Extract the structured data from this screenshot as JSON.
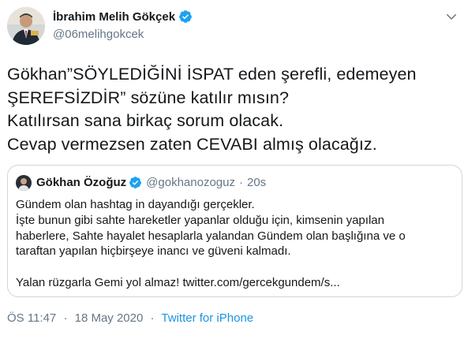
{
  "author": {
    "name": "İbrahim Melih Gökçek",
    "handle": "@06melihgokcek",
    "verified_color": "#1da1f2"
  },
  "tweet_lines": [
    "Gökhan”SÖYLEDİĞİNİ İSPAT eden şerefli, edemeyen",
    "ŞEREFSİZDİR” sözüne katılır mısın?",
    "Katılırsan sana birkaç sorum olacak.",
    "Cevap vermezsen zaten CEVABI almış olacağız."
  ],
  "quoted": {
    "name": "Gökhan Özoğuz",
    "handle": "@gokhanozoguz",
    "dot": "·",
    "time": "20s",
    "lines": [
      "Gündem olan hashtag in dayandığı gerçekler.",
      "İşte bunun gibi sahte hareketler yapanlar olduğu için, kimsenin yapılan",
      "haberlere, Sahte hayalet hesaplarla yalandan Gündem olan başlığına ve o",
      "taraftan yapılan hiçbirşeye inancı ve güveni kalmadı.",
      "",
      "Yalan rüzgarla Gemi yol almaz! twitter.com/gercekgundem/s..."
    ]
  },
  "meta": {
    "time": "ÖS 11:47",
    "dot1": "·",
    "date": "18 May 2020",
    "dot2": "·",
    "source": "Twitter for iPhone"
  },
  "icons": {
    "verified": "verified-badge-icon",
    "caret": "chevron-down-icon"
  },
  "colors": {
    "link": "#1b95e0",
    "secondary_text": "#657786",
    "border": "#ccd6dd"
  }
}
